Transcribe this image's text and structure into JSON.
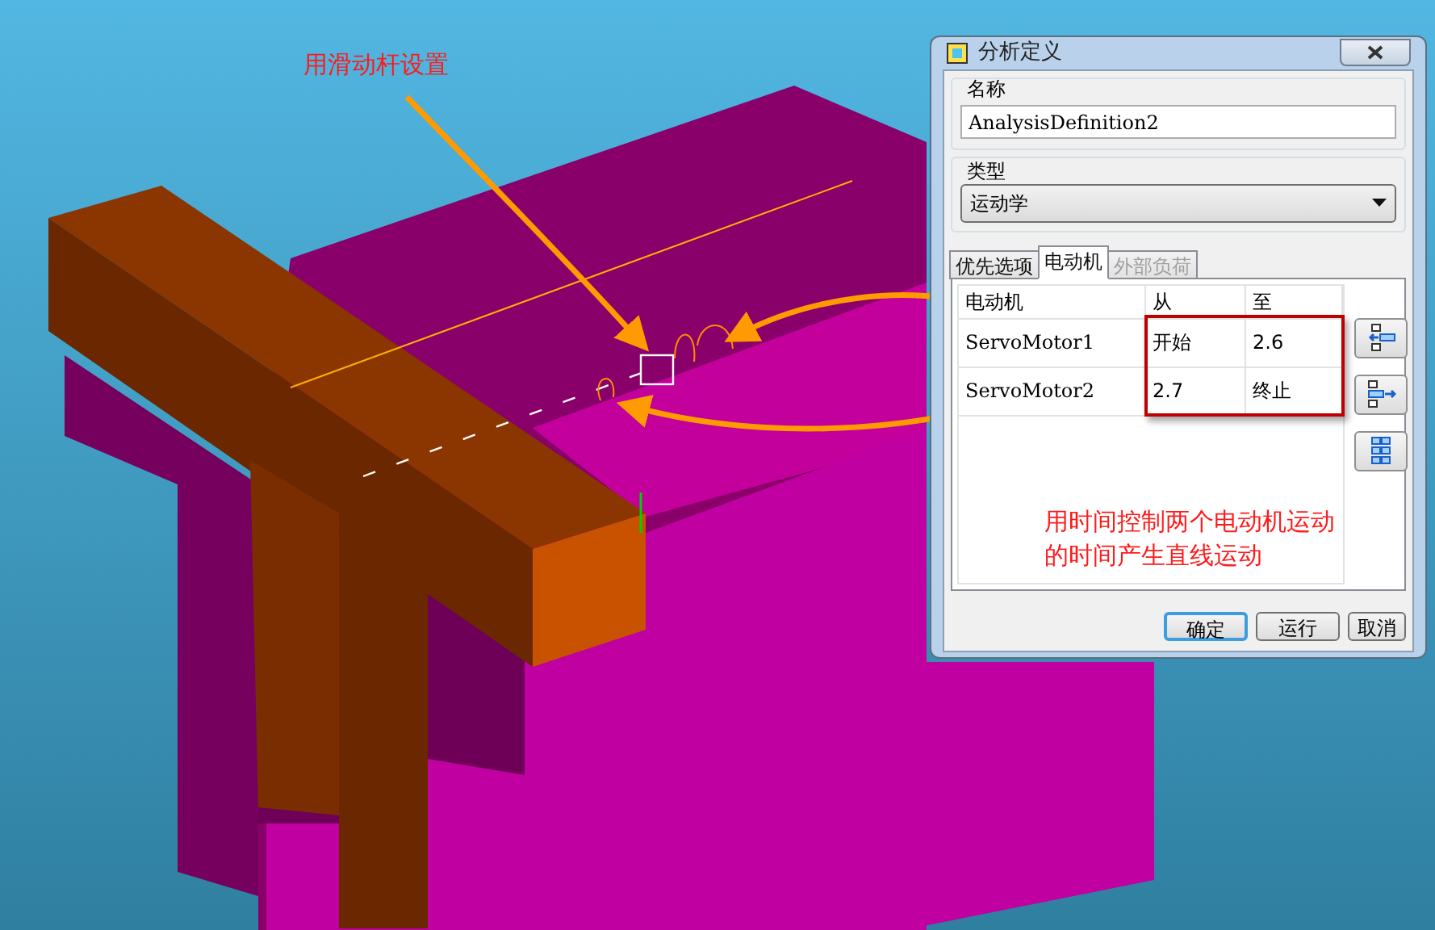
{
  "annotations": [
    {
      "text": "用滑动杆设置"
    },
    {
      "text": "用时间控制两个电动机运动的时间产生直线运动"
    }
  ],
  "dialog": {
    "title": "分析定义",
    "name_group": {
      "label": "名称",
      "value": "AnalysisDefinition2"
    },
    "type_group": {
      "label": "类型",
      "value": "运动学"
    },
    "tabs": [
      {
        "label": "优先选项",
        "selected": false,
        "disabled": false
      },
      {
        "label": "电动机",
        "selected": true,
        "disabled": false
      },
      {
        "label": "外部负荷",
        "selected": false,
        "disabled": true
      }
    ],
    "table": {
      "columns": [
        "电动机",
        "从",
        "至"
      ],
      "rows": [
        {
          "motor": "ServoMotor1",
          "from": "开始",
          "to": "2.6"
        },
        {
          "motor": "ServoMotor2",
          "from": "2.7",
          "to": "终止"
        }
      ]
    },
    "buttons": [
      {
        "label": "确定",
        "default": true
      },
      {
        "label": "运行",
        "default": false
      },
      {
        "label": "取消",
        "default": false
      }
    ]
  }
}
